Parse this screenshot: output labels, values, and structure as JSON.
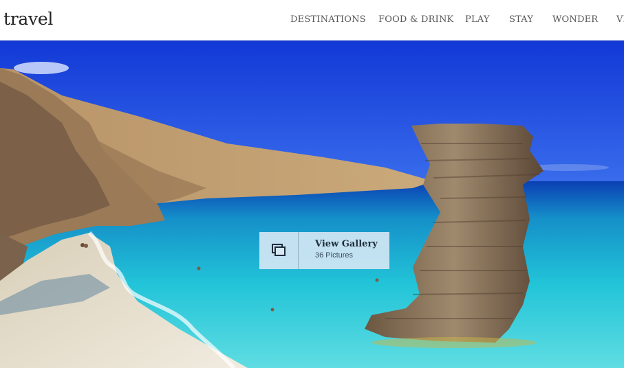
{
  "header": {
    "logo": "travel",
    "nav": [
      "DESTINATIONS",
      "FOOD & DRINK",
      "PLAY",
      "STAY",
      "WONDER",
      "VI"
    ]
  },
  "hero": {
    "image_description_icon": "beach-photo",
    "gallery_button": {
      "icon": "gallery-stack-icon",
      "title": "View Gallery",
      "subtitle": "36 Pictures"
    }
  },
  "colors": {
    "sky": "#1f4fe0",
    "sea": "#22c3d6",
    "sand": "#e9e2cf",
    "rock": "#8a6f55",
    "gallery_bg": "#d6e8f4"
  }
}
